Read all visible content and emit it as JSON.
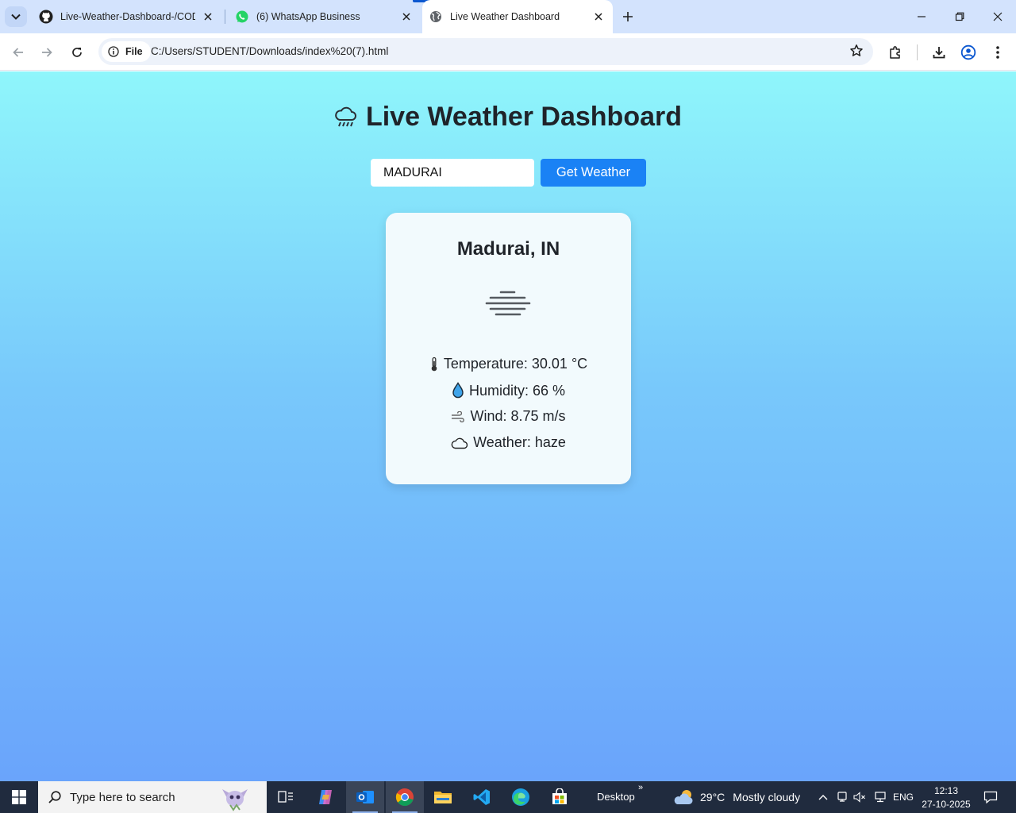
{
  "browser": {
    "tabs": [
      {
        "title": "Live-Weather-Dashboard-/CODE",
        "icon": "github-icon"
      },
      {
        "title": "(6) WhatsApp Business",
        "icon": "whatsapp-icon"
      },
      {
        "title": "Live Weather Dashboard",
        "icon": "globe-icon",
        "active": true
      }
    ],
    "chip_label": "File",
    "url": "C:/Users/STUDENT/Downloads/index%20(7).html"
  },
  "page": {
    "title": "Live Weather Dashboard",
    "title_icon": "cloud-rain-icon",
    "city_input_value": "MADURAI",
    "get_weather_label": "Get Weather",
    "card": {
      "city": "Madurai, IN",
      "weather_icon": "haze-icon",
      "temperature": "Temperature: 30.01 °C",
      "humidity": "Humidity: 66 %",
      "wind": "Wind: 8.75 m/s",
      "weather": "Weather: haze"
    }
  },
  "taskbar": {
    "search_placeholder": "Type here to search",
    "desktop_label": "Desktop",
    "chevron": "»",
    "weather_temp": "29°C",
    "weather_desc": "Mostly cloudy",
    "lang": "ENG",
    "time": "12:13",
    "date": "27-10-2025"
  },
  "colors": {
    "accent": "#1a82f5",
    "bg_top": "#8ff6fb",
    "bg_bottom": "#6aa4fb",
    "tab_strip": "#d3e3fd",
    "taskbar": "#202b3e"
  }
}
